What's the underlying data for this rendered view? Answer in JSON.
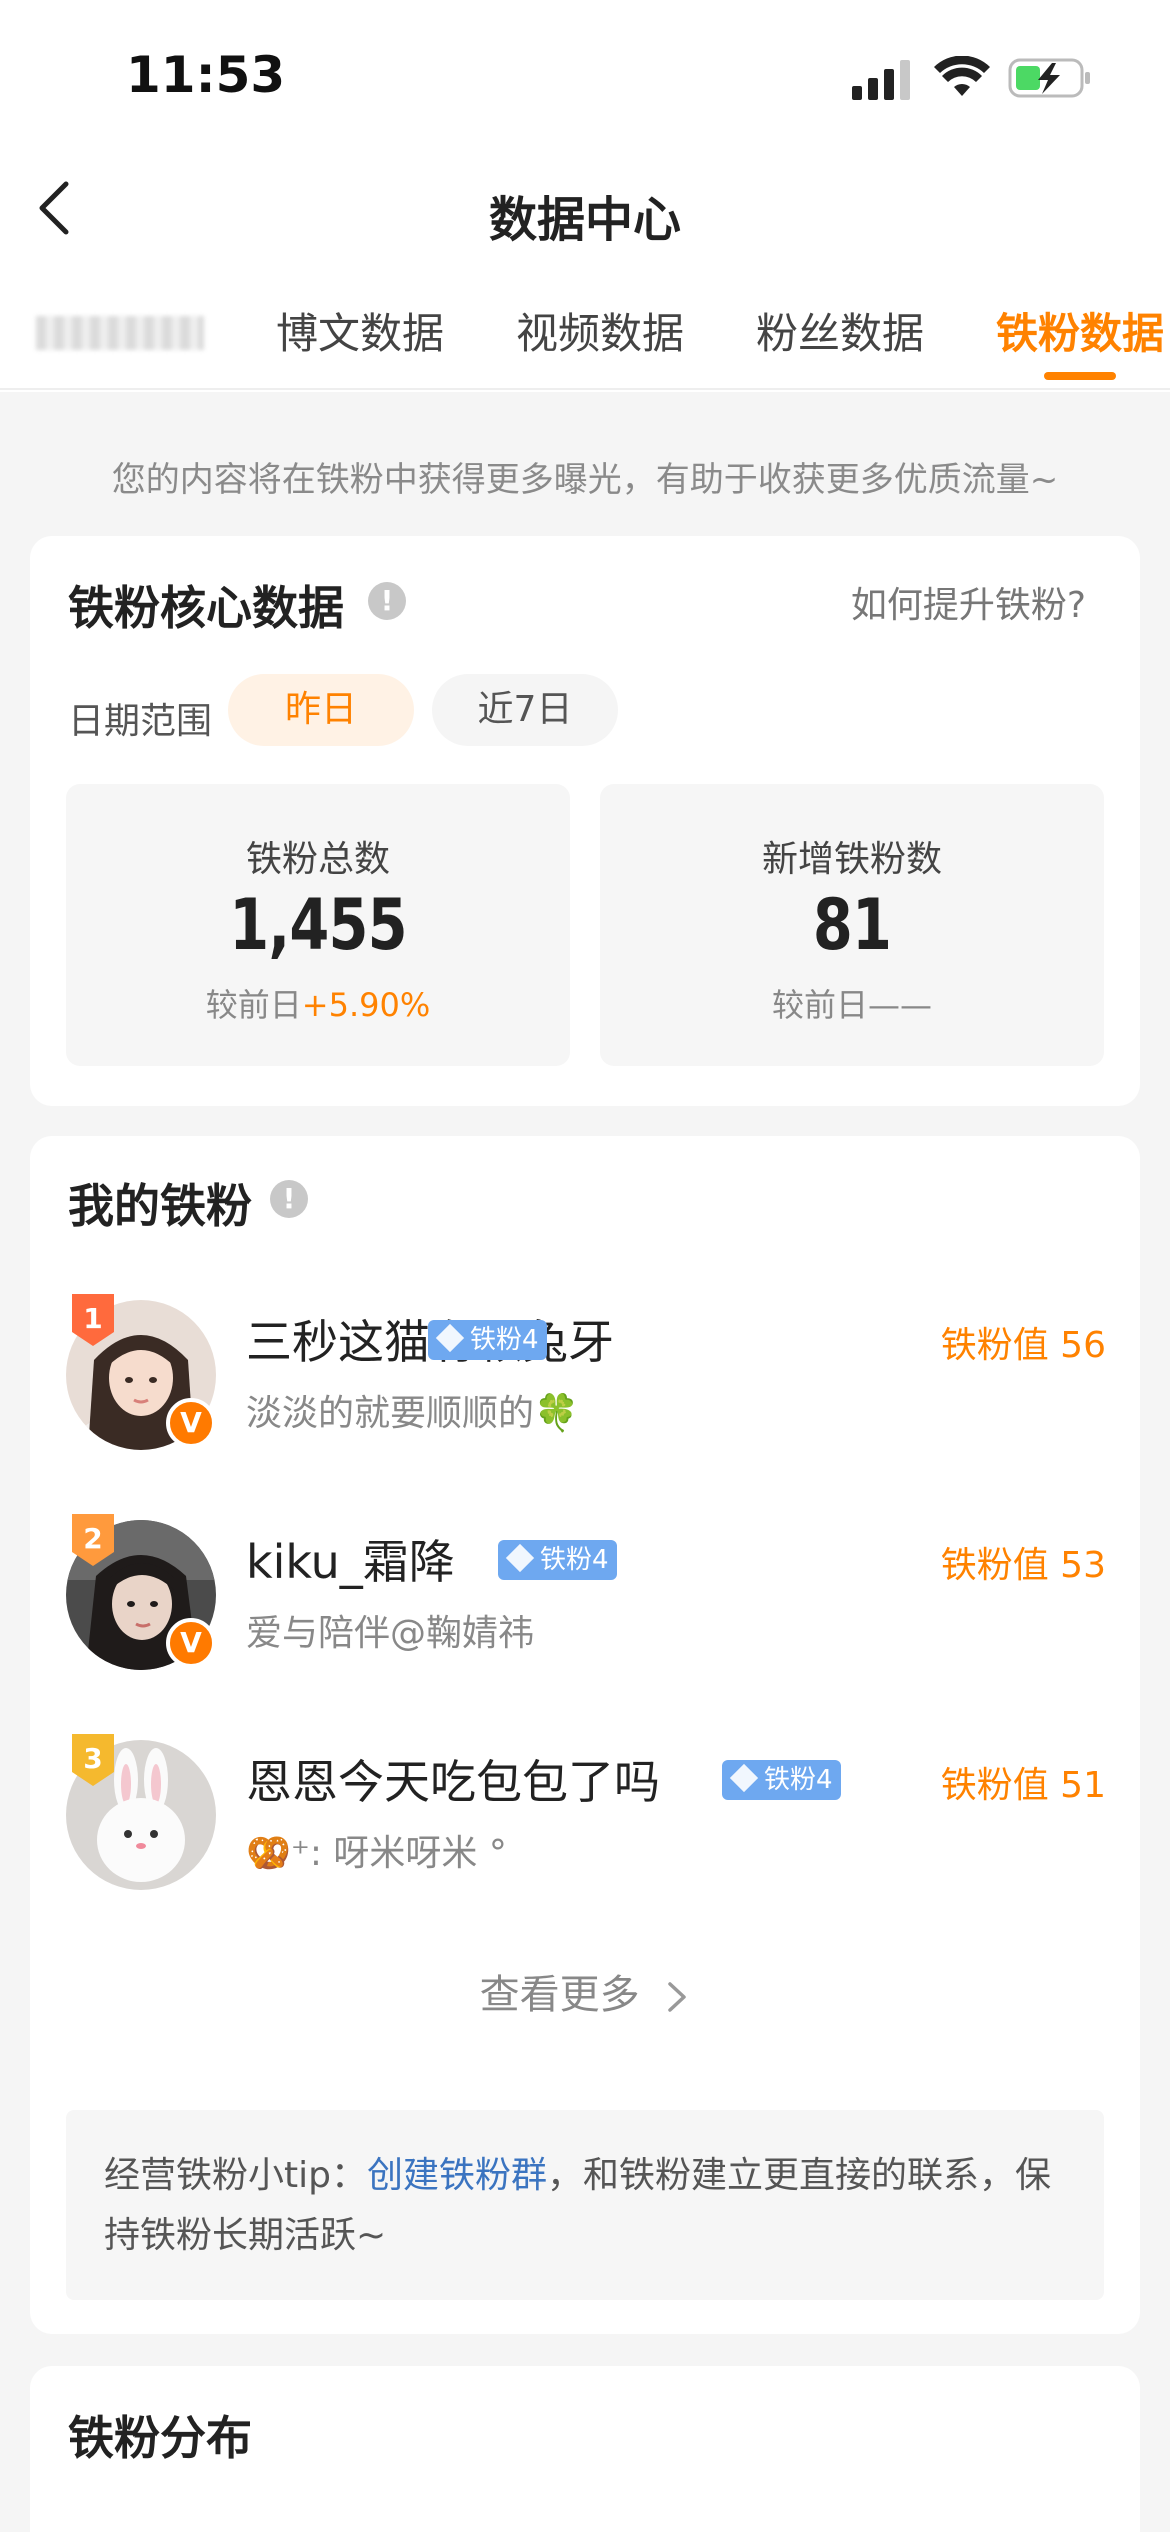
{
  "status_bar": {
    "time": "11:53"
  },
  "nav": {
    "title": "数据中心",
    "back_icon": "chevron-left-icon"
  },
  "tabs": [
    {
      "label": "博文数据",
      "active": false
    },
    {
      "label": "视频数据",
      "active": false
    },
    {
      "label": "粉丝数据",
      "active": false
    },
    {
      "label": "铁粉数据",
      "active": true
    }
  ],
  "hint": "您的内容将在铁粉中获得更多曝光，有助于收获更多优质流量~",
  "core": {
    "title": "铁粉核心数据",
    "info_icon": "!",
    "help_link": "如何提升铁粉?",
    "date_range_label": "日期范围",
    "date_options": [
      {
        "label": "昨日",
        "selected": true
      },
      {
        "label": "近7日",
        "selected": false
      }
    ],
    "stats": [
      {
        "label": "铁粉总数",
        "value": "1,455",
        "compare_prefix": "较前日",
        "compare_value": "+5.90%"
      },
      {
        "label": "新增铁粉数",
        "value": "81",
        "compare_prefix": "较前日",
        "compare_value": "——"
      }
    ]
  },
  "my_fans": {
    "title": "我的铁粉",
    "info_icon": "!",
    "items": [
      {
        "rank": "1",
        "name": "三秒这猫有颗兔牙",
        "badge": "铁粉4",
        "value_label": "铁粉值 56",
        "bio": "淡淡的就要顺顺的🍀",
        "verified": "V"
      },
      {
        "rank": "2",
        "name": "kiku_霜降",
        "badge": "铁粉4",
        "value_label": "铁粉值 53",
        "bio": "爱与陪伴@鞠婧祎",
        "verified": "V"
      },
      {
        "rank": "3",
        "name": "恩恩今天吃包包了吗",
        "badge": "铁粉4",
        "value_label": "铁粉值 51",
        "bio": "🥨⁺: 呀米呀米 °",
        "verified": ""
      }
    ],
    "see_more": "查看更多",
    "tip_prefix": "经营铁粉小tip：",
    "tip_link": "创建铁粉群",
    "tip_suffix": "，和铁粉建立更直接的联系，保持铁粉长期活跃~"
  },
  "distribution": {
    "title": "铁粉分布"
  },
  "colors": {
    "accent": "#ff8200",
    "link": "#3b74c0",
    "badge": "#6ea8f0"
  }
}
